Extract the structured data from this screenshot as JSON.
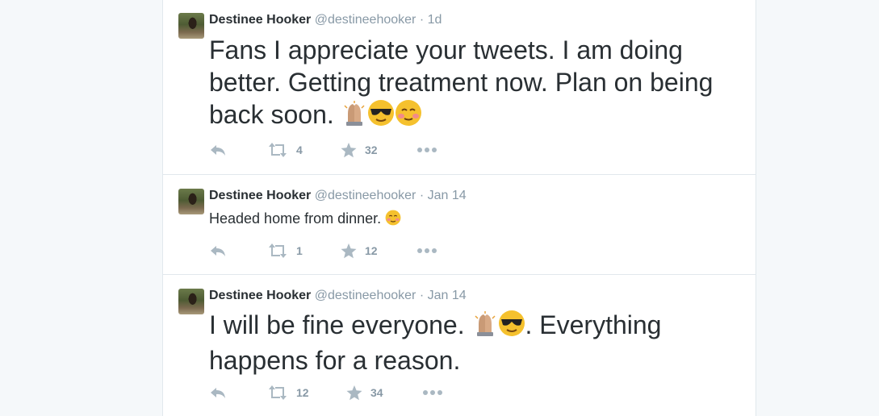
{
  "colors": {
    "name": "#292f33",
    "meta": "#8899a6",
    "icon": "#aab8c2",
    "background": "#f5f8fa"
  },
  "tweets": [
    {
      "name": "Destinee Hooker",
      "handle": "@destineehooker",
      "separator": "·",
      "time": "1d",
      "text": "Fans I appreciate your tweets. I am doing better. Getting treatment now. Plan on being back soon.",
      "emojis": [
        "folded-hands",
        "sunglasses-face",
        "smiling-blush-face"
      ],
      "retweets": "4",
      "favorites": "32"
    },
    {
      "name": "Destinee Hooker",
      "handle": "@destineehooker",
      "separator": "·",
      "time": "Jan 14",
      "text": "Headed home from dinner.",
      "emojis": [
        "smiling-blush-face"
      ],
      "retweets": "1",
      "favorites": "12"
    },
    {
      "name": "Destinee Hooker",
      "handle": "@destineehooker",
      "separator": "·",
      "time": "Jan 14",
      "text_part1": "I will be fine everyone.",
      "text_part2": ". Everything happens for a reason.",
      "emojis": [
        "folded-hands",
        "sunglasses-face"
      ],
      "retweets": "12",
      "favorites": "34"
    }
  ]
}
